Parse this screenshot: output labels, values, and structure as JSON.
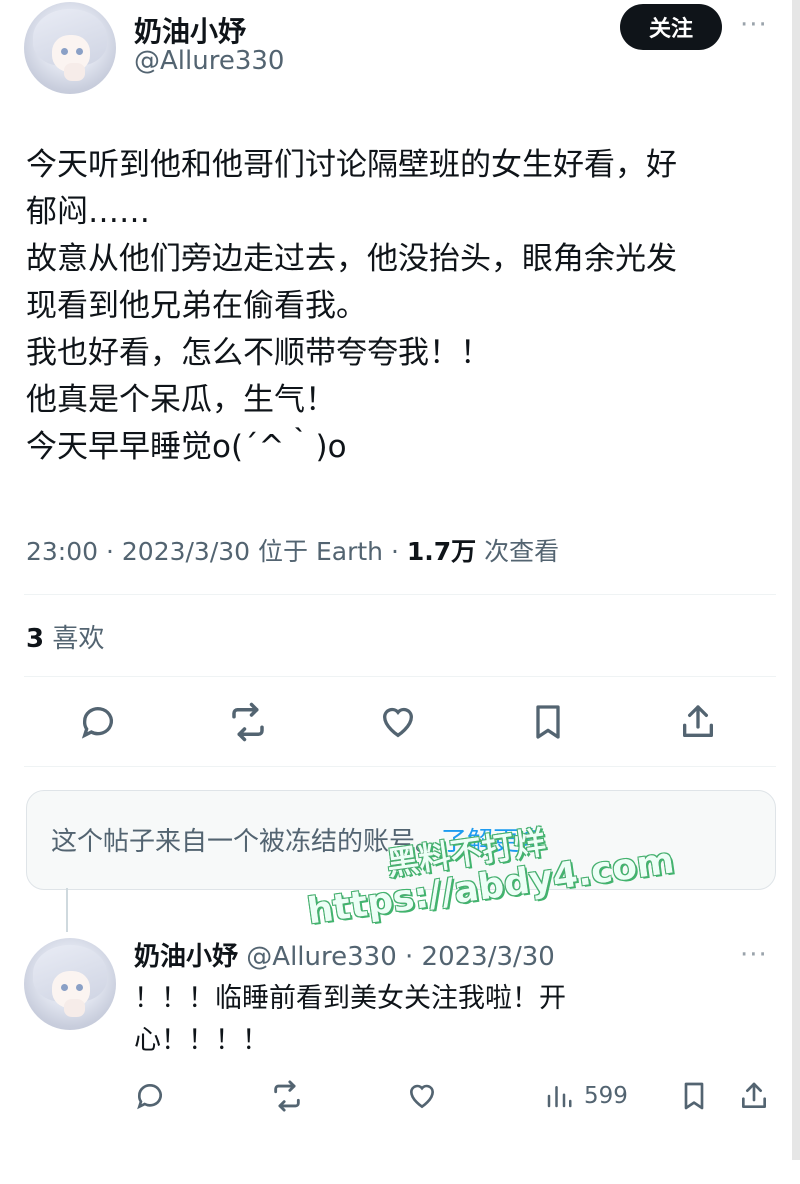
{
  "header": {
    "name": "奶油小妤",
    "handle": "@Allure330",
    "follow_label": "关注",
    "more_label": "···"
  },
  "tweet": {
    "lines": [
      "今天听到他和他哥们讨论隔壁班的女生好看，好",
      "郁闷……",
      "故意从他们旁边走过去，他没抬头，眼角余光发",
      "现看到他兄弟在偷看我。",
      "我也好看，怎么不顺带夸夸我！！",
      "他真是个呆瓜，生气！",
      "今天早早睡觉o(´^｀)o"
    ],
    "meta_time": "23:00 · 2023/3/30 位于 Earth · ",
    "views_count": "1.7万",
    "views_label": " 次查看",
    "likes_count": "3",
    "likes_label": " 喜欢"
  },
  "actions": {
    "reply": "reply-icon",
    "retweet": "retweet-icon",
    "like": "heart-icon",
    "bookmark": "bookmark-icon",
    "share": "share-icon"
  },
  "notice": {
    "text": "这个帖子来自一个被冻结的账号。",
    "link": "了解更多"
  },
  "reply": {
    "name": "奶油小妤",
    "meta": " @Allure330 · 2023/3/30",
    "more_label": "···",
    "lines": [
      "！！！临睡前看到美女关注我啦！开",
      "心！！！！"
    ],
    "views": "599"
  },
  "watermark": {
    "line1": "黑料不打烊",
    "line2": "https://abdy4.com"
  },
  "colors": {
    "text": "#0f1419",
    "muted": "#536471",
    "link": "#1d9bf0",
    "watermark_fill": "#ecfff6",
    "watermark_outline": "#42b46e"
  }
}
